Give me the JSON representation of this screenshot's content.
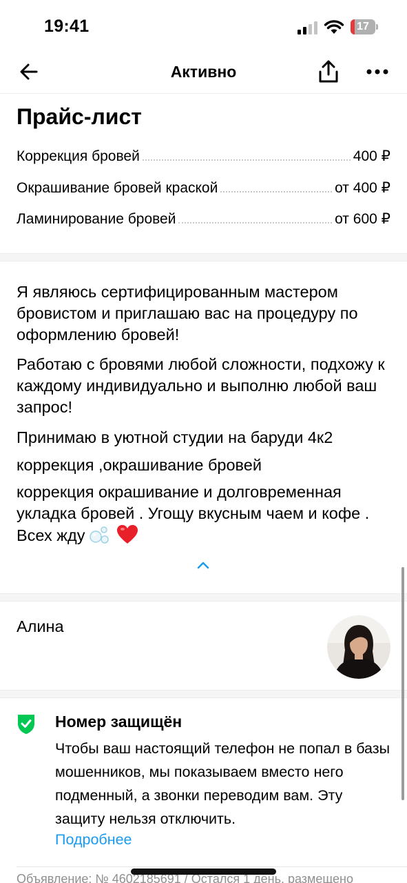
{
  "status_bar": {
    "time": "19:41",
    "battery_level": "17",
    "icons": [
      "cellular-signal-icon",
      "wifi-icon",
      "battery-icon"
    ],
    "battery_color": "#e5393b"
  },
  "nav": {
    "title": "Активно",
    "icons": [
      "back-arrow-icon",
      "share-icon",
      "more-icon"
    ]
  },
  "price_list": {
    "title": "Прайс-лист",
    "items": [
      {
        "name": "Коррекция бровей",
        "price": "400 ₽"
      },
      {
        "name": "Окрашивание бровей краской",
        "price": "от 400 ₽"
      },
      {
        "name": "Ламинирование бровей",
        "price": "от 600 ₽"
      }
    ]
  },
  "description": {
    "paragraphs": [
      "Я являюсь сертифицированным мастером бровистом и приглашаю вас на процедуру по оформлению бровей!",
      "Работаю с бровями любой сложности, подхожу к каждому индивидуально и выполню любой ваш запрос!",
      "Принимаю в уютной студии на баруди 4к2",
      "коррекция ,окрашивание бровей",
      "коррекция окрашивание и долговременная укладка бровей . Угощу вкусным чаем и кофе . Всех жду"
    ],
    "trailing_emoji": [
      "bubbles-icon",
      "heart-icon"
    ],
    "collapse_icon": "chevron-up-icon"
  },
  "seller": {
    "name": "Алина"
  },
  "protection": {
    "title": "Номер защищён",
    "text": "Чтобы ваш настоящий телефон не попал в базы мошенников, мы показываем вместо него подменный, а звонки переводим вам. Эту защиту нельзя отключить.",
    "link": "Подробнее",
    "accent_color": "#1a9bf0",
    "shield_color": "#00c853"
  },
  "footer": {
    "meta": "Объявление: № 4602185691 / Остался 1 день, размещено"
  }
}
